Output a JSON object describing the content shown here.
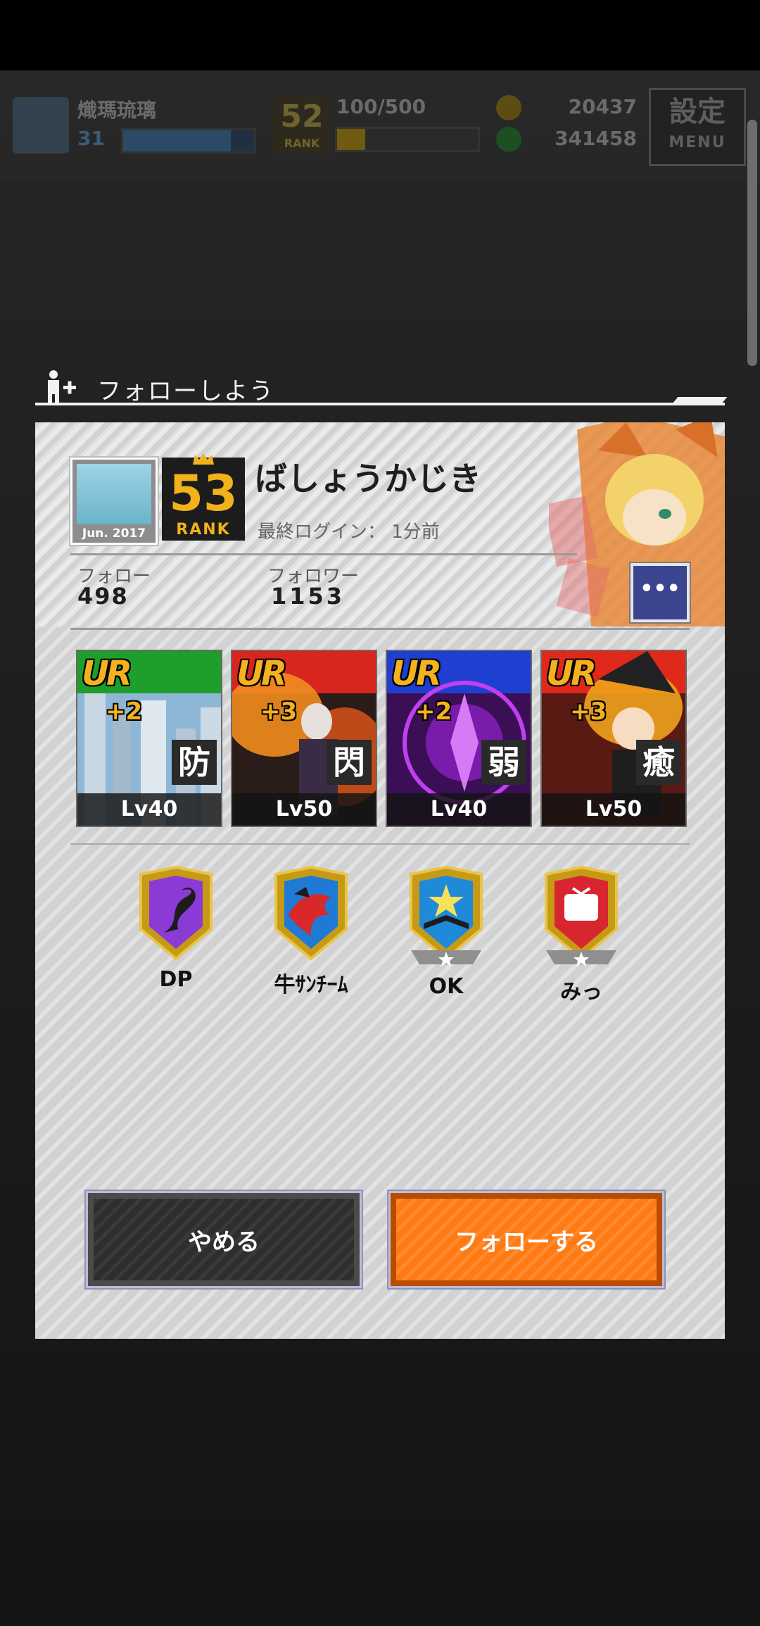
{
  "header": {
    "player_name": "熾瑪琉璃",
    "player_level": "31",
    "rank_number": "52",
    "rank_label": "RANK",
    "stamina": "100/500",
    "stamina_fraction": 0.2,
    "exp_fraction": 0.82,
    "coin_amount": "20437",
    "gem_amount": "341458",
    "menu_kanji": "設定",
    "menu_label": "MENU"
  },
  "dialog": {
    "title": "フォローしよう",
    "profile": {
      "badge_label": "Jun. 2017",
      "rank_number": "53",
      "rank_label": "RANK",
      "name": "ばしょうかじき",
      "last_login": "最終ログイン： 1分前",
      "follow_label": "フォロー",
      "follow_count": "498",
      "follower_label": "フォロワー",
      "follower_count": "1153",
      "more_button": "•••"
    },
    "cards": [
      {
        "rarity": "UR",
        "plus": "+2",
        "attr": "防",
        "level": "Lv40"
      },
      {
        "rarity": "UR",
        "plus": "+3",
        "attr": "閃",
        "level": "Lv50"
      },
      {
        "rarity": "UR",
        "plus": "+2",
        "attr": "弱",
        "level": "Lv40"
      },
      {
        "rarity": "UR",
        "plus": "+3",
        "attr": "癒",
        "level": "Lv50"
      }
    ],
    "emblems": [
      {
        "name": "DP",
        "icon": "dragon-emblem-icon"
      },
      {
        "name": "牛ｻﾝﾁｰﾑ",
        "icon": "red-dragon-emblem-icon"
      },
      {
        "name": "OK",
        "icon": "star-emblem-icon"
      },
      {
        "name": "みっ",
        "icon": "tv-emblem-icon"
      }
    ],
    "cancel_button": "やめる",
    "follow_button": "フォローする"
  },
  "colors": {
    "accent_orange": "#ff7a12",
    "rank_gold": "#f1b21b",
    "panel_grey": "#d2d2d2"
  }
}
